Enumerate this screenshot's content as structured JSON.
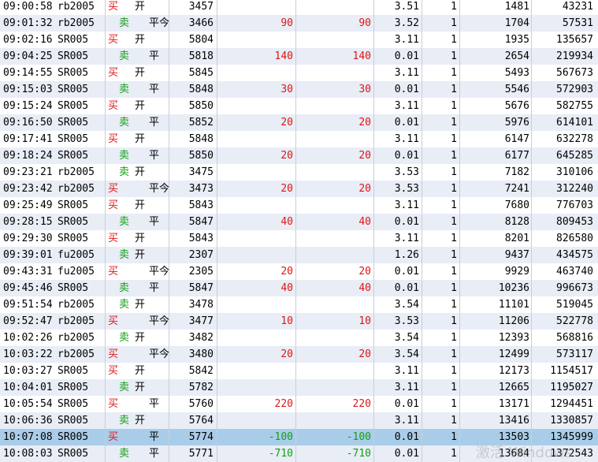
{
  "colors": {
    "buy": "#e01515",
    "sell": "#14a014",
    "row_alt": "#e8edf6",
    "row_selected": "#a9cde9"
  },
  "watermark": "激活 Windows",
  "rows": [
    {
      "time": "09:00:58",
      "code": "rb2005",
      "side": "买",
      "offset": "开",
      "price": "3457",
      "v1": "",
      "v2": "",
      "rate": "3.51",
      "lots": "1",
      "q1": "1481",
      "q2": "43231"
    },
    {
      "time": "09:01:32",
      "code": "rb2005",
      "side": "卖",
      "offset": "平今",
      "price": "3466",
      "v1": "90",
      "v2": "90",
      "rate": "3.52",
      "lots": "1",
      "q1": "1704",
      "q2": "57531"
    },
    {
      "time": "09:02:16",
      "code": "SR005",
      "side": "买",
      "offset": "开",
      "price": "5804",
      "v1": "",
      "v2": "",
      "rate": "3.11",
      "lots": "1",
      "q1": "1935",
      "q2": "135657"
    },
    {
      "time": "09:04:25",
      "code": "SR005",
      "side": "卖",
      "offset": "平",
      "price": "5818",
      "v1": "140",
      "v2": "140",
      "rate": "0.01",
      "lots": "1",
      "q1": "2654",
      "q2": "219934"
    },
    {
      "time": "09:14:55",
      "code": "SR005",
      "side": "买",
      "offset": "开",
      "price": "5845",
      "v1": "",
      "v2": "",
      "rate": "3.11",
      "lots": "1",
      "q1": "5493",
      "q2": "567673"
    },
    {
      "time": "09:15:03",
      "code": "SR005",
      "side": "卖",
      "offset": "平",
      "price": "5848",
      "v1": "30",
      "v2": "30",
      "rate": "0.01",
      "lots": "1",
      "q1": "5546",
      "q2": "572903"
    },
    {
      "time": "09:15:24",
      "code": "SR005",
      "side": "买",
      "offset": "开",
      "price": "5850",
      "v1": "",
      "v2": "",
      "rate": "3.11",
      "lots": "1",
      "q1": "5676",
      "q2": "582755"
    },
    {
      "time": "09:16:50",
      "code": "SR005",
      "side": "卖",
      "offset": "平",
      "price": "5852",
      "v1": "20",
      "v2": "20",
      "rate": "0.01",
      "lots": "1",
      "q1": "5976",
      "q2": "614101"
    },
    {
      "time": "09:17:41",
      "code": "SR005",
      "side": "买",
      "offset": "开",
      "price": "5848",
      "v1": "",
      "v2": "",
      "rate": "3.11",
      "lots": "1",
      "q1": "6147",
      "q2": "632278"
    },
    {
      "time": "09:18:24",
      "code": "SR005",
      "side": "卖",
      "offset": "平",
      "price": "5850",
      "v1": "20",
      "v2": "20",
      "rate": "0.01",
      "lots": "1",
      "q1": "6177",
      "q2": "645285"
    },
    {
      "time": "09:23:21",
      "code": "rb2005",
      "side": "卖",
      "offset": "开",
      "price": "3475",
      "v1": "",
      "v2": "",
      "rate": "3.53",
      "lots": "1",
      "q1": "7182",
      "q2": "310106"
    },
    {
      "time": "09:23:42",
      "code": "rb2005",
      "side": "买",
      "offset": "平今",
      "price": "3473",
      "v1": "20",
      "v2": "20",
      "rate": "3.53",
      "lots": "1",
      "q1": "7241",
      "q2": "312240"
    },
    {
      "time": "09:25:49",
      "code": "SR005",
      "side": "买",
      "offset": "开",
      "price": "5843",
      "v1": "",
      "v2": "",
      "rate": "3.11",
      "lots": "1",
      "q1": "7680",
      "q2": "776703"
    },
    {
      "time": "09:28:15",
      "code": "SR005",
      "side": "卖",
      "offset": "平",
      "price": "5847",
      "v1": "40",
      "v2": "40",
      "rate": "0.01",
      "lots": "1",
      "q1": "8128",
      "q2": "809453"
    },
    {
      "time": "09:29:30",
      "code": "SR005",
      "side": "买",
      "offset": "开",
      "price": "5843",
      "v1": "",
      "v2": "",
      "rate": "3.11",
      "lots": "1",
      "q1": "8201",
      "q2": "826580"
    },
    {
      "time": "09:39:01",
      "code": "fu2005",
      "side": "卖",
      "offset": "开",
      "price": "2307",
      "v1": "",
      "v2": "",
      "rate": "1.26",
      "lots": "1",
      "q1": "9437",
      "q2": "434575"
    },
    {
      "time": "09:43:31",
      "code": "fu2005",
      "side": "买",
      "offset": "平今",
      "price": "2305",
      "v1": "20",
      "v2": "20",
      "rate": "0.01",
      "lots": "1",
      "q1": "9929",
      "q2": "463740"
    },
    {
      "time": "09:45:46",
      "code": "SR005",
      "side": "卖",
      "offset": "平",
      "price": "5847",
      "v1": "40",
      "v2": "40",
      "rate": "0.01",
      "lots": "1",
      "q1": "10236",
      "q2": "996673"
    },
    {
      "time": "09:51:54",
      "code": "rb2005",
      "side": "卖",
      "offset": "开",
      "price": "3478",
      "v1": "",
      "v2": "",
      "rate": "3.54",
      "lots": "1",
      "q1": "11101",
      "q2": "519045"
    },
    {
      "time": "09:52:47",
      "code": "rb2005",
      "side": "买",
      "offset": "平今",
      "price": "3477",
      "v1": "10",
      "v2": "10",
      "rate": "3.53",
      "lots": "1",
      "q1": "11206",
      "q2": "522778"
    },
    {
      "time": "10:02:26",
      "code": "rb2005",
      "side": "卖",
      "offset": "开",
      "price": "3482",
      "v1": "",
      "v2": "",
      "rate": "3.54",
      "lots": "1",
      "q1": "12393",
      "q2": "568816"
    },
    {
      "time": "10:03:22",
      "code": "rb2005",
      "side": "买",
      "offset": "平今",
      "price": "3480",
      "v1": "20",
      "v2": "20",
      "rate": "3.54",
      "lots": "1",
      "q1": "12499",
      "q2": "573117"
    },
    {
      "time": "10:03:27",
      "code": "SR005",
      "side": "买",
      "offset": "开",
      "price": "5842",
      "v1": "",
      "v2": "",
      "rate": "3.11",
      "lots": "1",
      "q1": "12173",
      "q2": "1154517"
    },
    {
      "time": "10:04:01",
      "code": "SR005",
      "side": "卖",
      "offset": "开",
      "price": "5782",
      "v1": "",
      "v2": "",
      "rate": "3.11",
      "lots": "1",
      "q1": "12665",
      "q2": "1195027"
    },
    {
      "time": "10:05:54",
      "code": "SR005",
      "side": "买",
      "offset": "平",
      "price": "5760",
      "v1": "220",
      "v2": "220",
      "rate": "0.01",
      "lots": "1",
      "q1": "13171",
      "q2": "1294451"
    },
    {
      "time": "10:06:36",
      "code": "SR005",
      "side": "卖",
      "offset": "开",
      "price": "5764",
      "v1": "",
      "v2": "",
      "rate": "3.11",
      "lots": "1",
      "q1": "13416",
      "q2": "1330857"
    },
    {
      "time": "10:07:08",
      "code": "SR005",
      "side": "买",
      "offset": "平",
      "price": "5774",
      "v1": "-100",
      "v2": "-100",
      "rate": "0.01",
      "lots": "1",
      "q1": "13503",
      "q2": "1345999",
      "selected": true
    },
    {
      "time": "10:08:03",
      "code": "SR005",
      "side": "卖",
      "offset": "平",
      "price": "5771",
      "v1": "-710",
      "v2": "-710",
      "rate": "0.01",
      "lots": "1",
      "q1": "13684",
      "q2": "1372543"
    }
  ]
}
